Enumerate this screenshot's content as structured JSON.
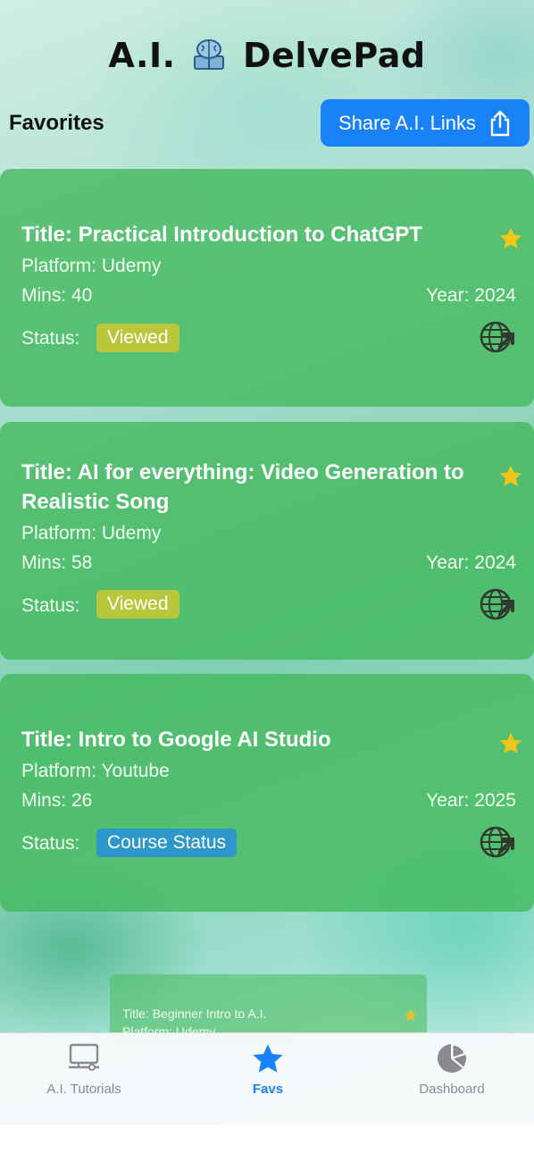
{
  "app_title_left": "A.I.",
  "app_title_right": "DelvePad",
  "favorites_label": "Favorites",
  "share_button_label": "Share A.I. Links",
  "cards": [
    {
      "title": "Title: Practical Introduction to ChatGPT",
      "platform": "Platform: Udemy",
      "mins": "Mins: 40",
      "year": "Year: 2024",
      "status_label": "Status:",
      "status": "Viewed"
    },
    {
      "title": "Title: AI for everything: Video Generation to Realistic Song",
      "platform": "Platform: Udemy",
      "mins": "Mins: 58",
      "year": "Year: 2024",
      "status_label": "Status:",
      "status": "Viewed"
    },
    {
      "title": "Title: Intro to Google AI Studio",
      "platform": "Platform: Youtube",
      "mins": "Mins: 26",
      "year": "Year: 2025",
      "status_label": "Status:",
      "status": "Course Status"
    }
  ],
  "peek_card": {
    "title": "Title: Beginner Intro to A.I.",
    "platform": "Platform: Udemy"
  },
  "tabs": [
    {
      "label": "A.I. Tutorials",
      "icon": "laptop-icon",
      "active": false
    },
    {
      "label": "Favs",
      "icon": "star-icon",
      "active": true
    },
    {
      "label": "Dashboard",
      "icon": "pie-chart-icon",
      "active": false
    }
  ],
  "colors": {
    "accent": "#1a82f7",
    "card": "#46b95f",
    "viewed_badge": "#b8c83a",
    "course_badge": "#2d98c9",
    "star": "#f5c518"
  }
}
